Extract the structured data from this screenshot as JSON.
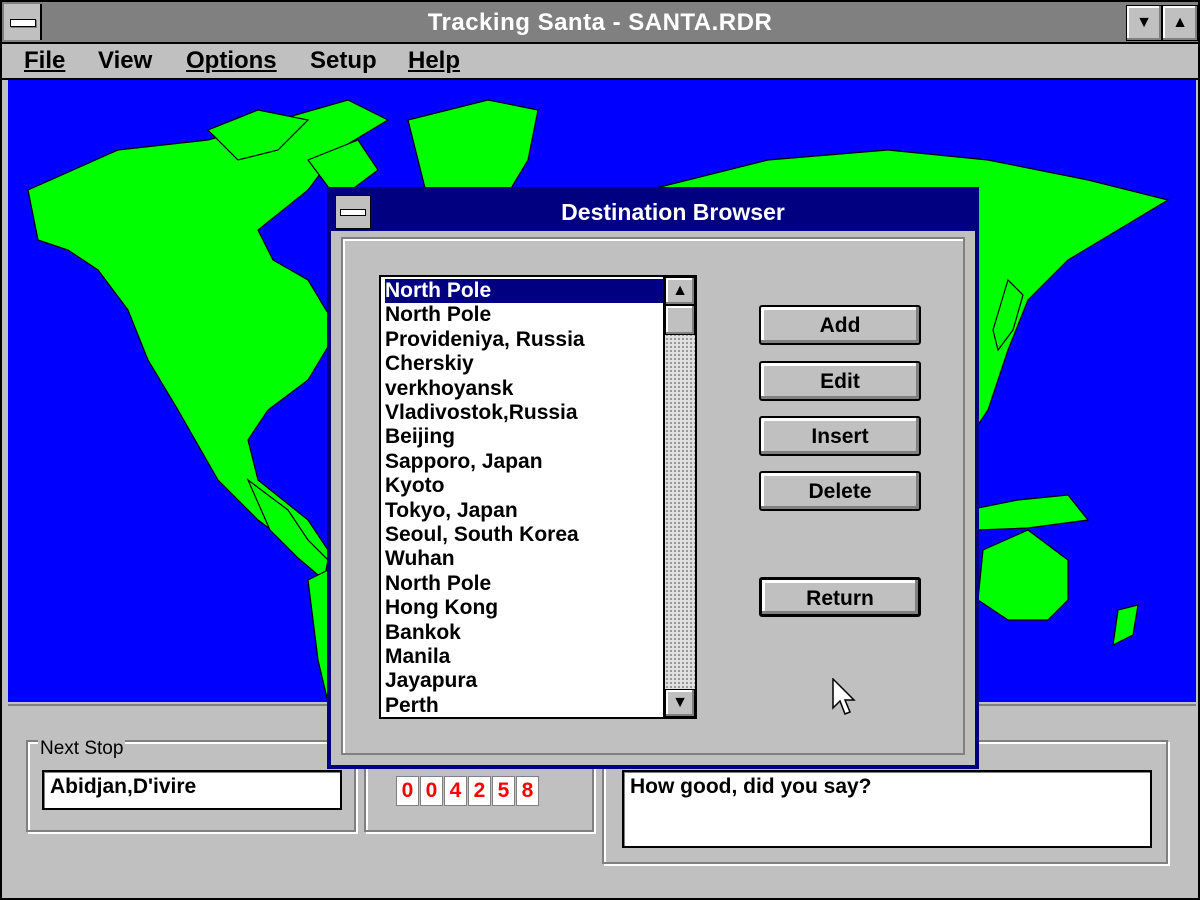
{
  "window": {
    "title": "Tracking Santa - SANTA.RDR"
  },
  "menu": {
    "items": [
      {
        "label": "File"
      },
      {
        "label": "View"
      },
      {
        "label": "Options"
      },
      {
        "label": "Setup"
      },
      {
        "label": "Help"
      }
    ]
  },
  "colors": {
    "ocean": "#0000ff",
    "land": "#00ff00",
    "title_active": "#000080",
    "counter_digits": "#ff0000"
  },
  "dialog": {
    "title": "Destination Browser",
    "destinations": [
      "North Pole",
      "North Pole",
      "Provideniya, Russia",
      "Cherskiy",
      "verkhoyansk",
      "Vladivostok,Russia",
      "Beijing",
      "Sapporo, Japan",
      "Kyoto",
      "Tokyo, Japan",
      "Seoul, South Korea",
      "Wuhan",
      "North Pole",
      "Hong Kong",
      "Bankok",
      "Manila",
      "Jayapura",
      "Perth"
    ],
    "selected_index": 0,
    "buttons": {
      "add": "Add",
      "edit": "Edit",
      "insert": "Insert",
      "delete": "Delete",
      "return": "Return"
    },
    "scroll_up_icon": "up-arrow-icon",
    "scroll_down_icon": "down-arrow-icon"
  },
  "status": {
    "next_stop_label": "Next Stop",
    "next_stop_value": "Abidjan,D'ivire",
    "counter_digits": [
      "0",
      "0",
      "4",
      "2",
      "5",
      "8"
    ],
    "message": "How good, did you say?"
  }
}
